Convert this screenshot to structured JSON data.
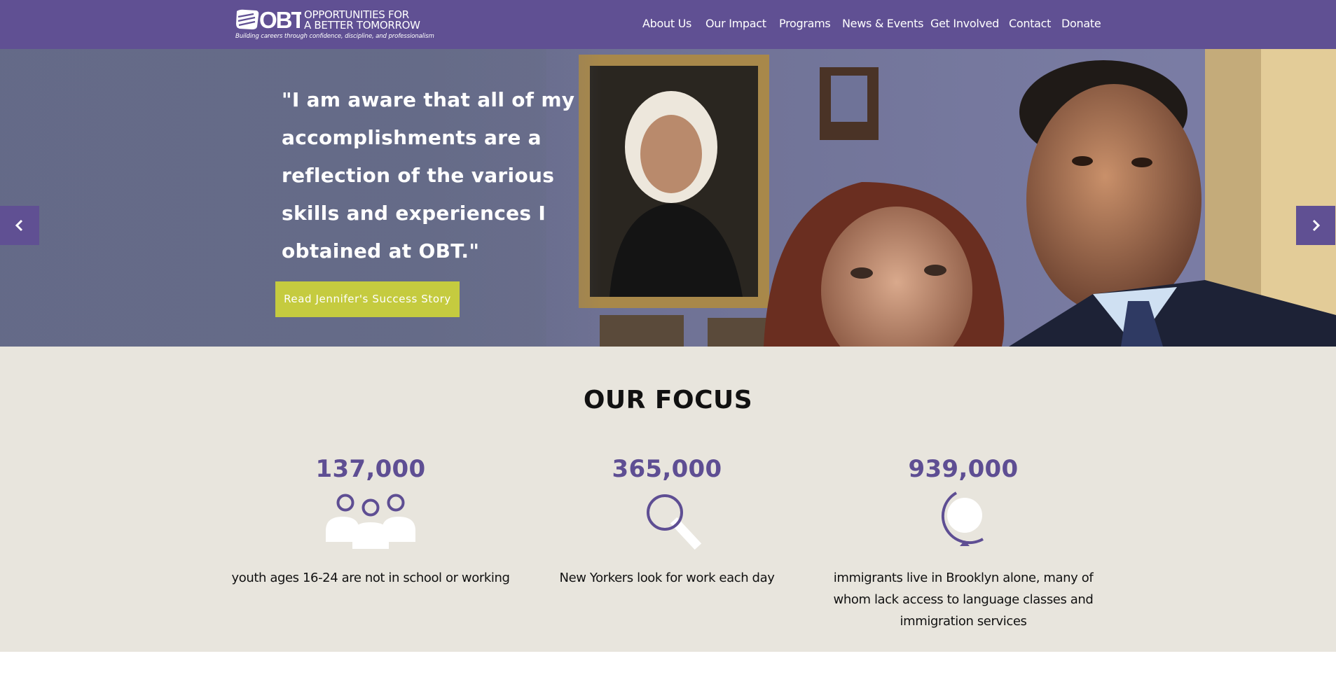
{
  "header": {
    "logo_mark": "OBT",
    "logo_line1": "OPPORTUNITIES FOR",
    "logo_line2": "A BETTER TOMORROW",
    "tagline": "Building careers through confidence, discipline, and professionalism",
    "background_color": "#605093"
  },
  "nav": {
    "items": [
      {
        "label": "About Us"
      },
      {
        "label": "Our Impact"
      },
      {
        "label": "Programs"
      },
      {
        "label": "News & Events"
      },
      {
        "label": "Get Involved"
      },
      {
        "label": "Contact"
      },
      {
        "label": "Donate"
      }
    ]
  },
  "hero": {
    "quote": "\"I am aware that all of my accomplishments are a reflection of the various skills and experiences I obtained at OBT.\"",
    "cta_label": "Read Jennifer's Success Story",
    "cta_color": "#c5cb3f",
    "prev_icon": "chevron-left-icon",
    "next_icon": "chevron-right-icon"
  },
  "focus": {
    "title": "OUR FOCUS",
    "accent_color": "#5e4e93",
    "stats": [
      {
        "number": "137,000",
        "icon": "people-group-icon",
        "text": "youth ages 16-24 are not in school or working"
      },
      {
        "number": "365,000",
        "icon": "magnifier-icon",
        "text": "New Yorkers look for work each day"
      },
      {
        "number": "939,000",
        "icon": "globe-icon",
        "text": "immigrants live in Brooklyn alone, many of whom lack access to language classes and immigration services"
      }
    ]
  }
}
